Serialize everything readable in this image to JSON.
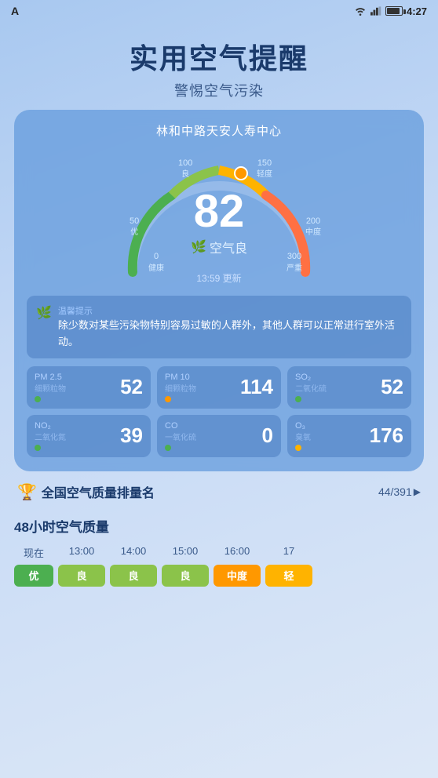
{
  "statusBar": {
    "appName": "A",
    "time": "4:27",
    "icons": [
      "wifi",
      "signal",
      "battery"
    ]
  },
  "header": {
    "title": "实用空气提醒",
    "subtitle": "警惕空气污染"
  },
  "card": {
    "stationName": "林和中路天安人寿中心",
    "gaugeValue": "82",
    "gaugeLabel": "空气良",
    "gaugeTime": "13:59 更新",
    "scaleLabels": [
      {
        "value": "0",
        "unit": "健康",
        "position": "left-bottom"
      },
      {
        "value": "50",
        "unit": "优",
        "position": "left-mid"
      },
      {
        "value": "100",
        "unit": "良",
        "position": "top-left"
      },
      {
        "value": "150",
        "unit": "轻度",
        "position": "top-right"
      },
      {
        "value": "200",
        "unit": "中度",
        "position": "right-mid"
      },
      {
        "value": "300",
        "unit": "严重",
        "position": "right-bottom"
      }
    ],
    "tip": {
      "label": "温馨提示",
      "text": "除少数对某些污染物特别容易过敏的人群外，其他人群可以正常进行室外活动。"
    },
    "pollutants": [
      {
        "name": "PM 2.5",
        "unit": "细颗粒物",
        "value": "52",
        "dotColor": "#4caf50"
      },
      {
        "name": "PM 10",
        "unit": "细颗粒物",
        "value": "114",
        "dotColor": "#ff9800"
      },
      {
        "name": "SO₂",
        "unit": "二氧化硫",
        "value": "52",
        "dotColor": "#4caf50"
      },
      {
        "name": "NO₂",
        "unit": "二氧化氮",
        "value": "39",
        "dotColor": "#4caf50"
      },
      {
        "name": "CO",
        "unit": "一氧化硫",
        "value": "0",
        "dotColor": "#4caf50"
      },
      {
        "name": "O₃",
        "unit": "臭氧",
        "value": "176",
        "dotColor": "#ffb300"
      }
    ]
  },
  "ranking": {
    "label": "全国空气质量排量名",
    "value": "44/391",
    "chevron": "▶"
  },
  "quality48h": {
    "title": "48小时空气质量",
    "timeLabels": [
      "现在",
      "13:00",
      "14:00",
      "15:00",
      "16:00",
      "17"
    ],
    "badges": [
      {
        "label": "优",
        "class": "badge-excellent"
      },
      {
        "label": "良",
        "class": "badge-good"
      },
      {
        "label": "良",
        "class": "badge-good"
      },
      {
        "label": "良",
        "class": "badge-good"
      },
      {
        "label": "中度",
        "class": "badge-moderate"
      },
      {
        "label": "轻",
        "class": "badge-light"
      }
    ]
  }
}
